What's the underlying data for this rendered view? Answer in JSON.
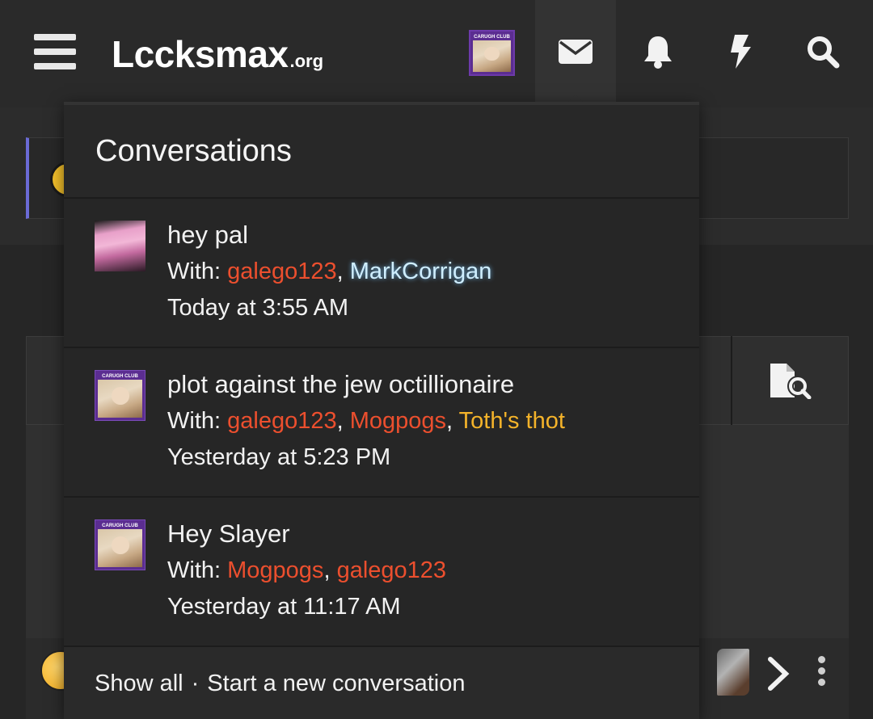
{
  "header": {
    "logo_main": "Lccksmax",
    "logo_tld": ".org",
    "avatar_label": "CARUGH CLUB",
    "icons": [
      "menu-icon",
      "envelope-icon",
      "bell-icon",
      "bolt-icon",
      "search-icon"
    ]
  },
  "background": {
    "toolbar_icon": "search-document-icon"
  },
  "menu": {
    "title": "Conversations",
    "conversations": [
      {
        "title": "hey pal",
        "with_label": "With:",
        "participants": [
          {
            "name": "galego123",
            "color": "#ec4f2e"
          },
          {
            "name": "MarkCorrigan",
            "color": "#cfeeff"
          }
        ],
        "date": "Today at 3:55 AM"
      },
      {
        "title": "plot against the jew octillionaire",
        "with_label": "With:",
        "participants": [
          {
            "name": "galego123",
            "color": "#ec4f2e"
          },
          {
            "name": "Mogpogs",
            "color": "#ec4f2e"
          },
          {
            "name": "Toth's thot",
            "color": "#f4b32a"
          }
        ],
        "date": "Yesterday at 5:23 PM"
      },
      {
        "title": "Hey Slayer",
        "with_label": "With:",
        "participants": [
          {
            "name": "Mogpogs",
            "color": "#ec4f2e"
          },
          {
            "name": "galego123",
            "color": "#ec4f2e"
          }
        ],
        "date": "Yesterday at 11:17 AM"
      }
    ],
    "footer": {
      "show_all": "Show all",
      "separator": "·",
      "start_new": "Start a new conversation"
    }
  },
  "colors": {
    "accent_red": "#ec4f2e",
    "accent_gold": "#f4b32a",
    "glow_blue": "#cfeeff",
    "notice_border": "#6b6bd6"
  }
}
